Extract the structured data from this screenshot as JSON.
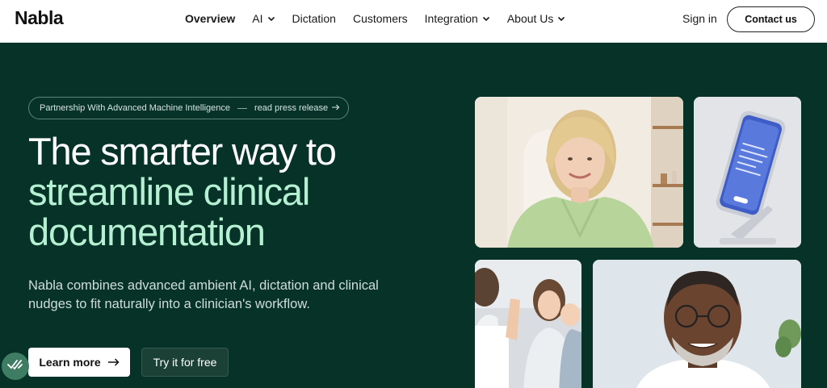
{
  "nav": {
    "logo": "Nabla",
    "items": [
      {
        "label": "Overview",
        "has_dropdown": false,
        "active": true
      },
      {
        "label": "AI",
        "has_dropdown": true,
        "active": false
      },
      {
        "label": "Dictation",
        "has_dropdown": false,
        "active": false
      },
      {
        "label": "Customers",
        "has_dropdown": false,
        "active": false
      },
      {
        "label": "Integration",
        "has_dropdown": true,
        "active": false
      },
      {
        "label": "About Us",
        "has_dropdown": true,
        "active": false
      }
    ],
    "sign_in": "Sign in",
    "contact": "Contact us"
  },
  "hero": {
    "announcement": {
      "text": "Partnership With Advanced Machine Intelligence",
      "link": "read press release",
      "arrow_icon": "arrow-right-icon"
    },
    "headline": {
      "line1": "The smarter way to",
      "line2": "streamline clinical",
      "line3": "documentation"
    },
    "description": "Nabla combines advanced ambient AI, dictation and clinical nudges to fit naturally into a clinician's workflow.",
    "buttons": {
      "learn_more": "Learn more",
      "try_free": "Try it for free"
    },
    "images": [
      {
        "name": "woman-green-sweater-photo"
      },
      {
        "name": "phone-on-stand-photo"
      },
      {
        "name": "doctor-high-five-child-photo"
      },
      {
        "name": "smiling-man-glasses-photo"
      }
    ]
  },
  "colors": {
    "hero_bg": "#063228",
    "accent_mint": "#b5f0d3",
    "fab": "#3e7d63"
  }
}
